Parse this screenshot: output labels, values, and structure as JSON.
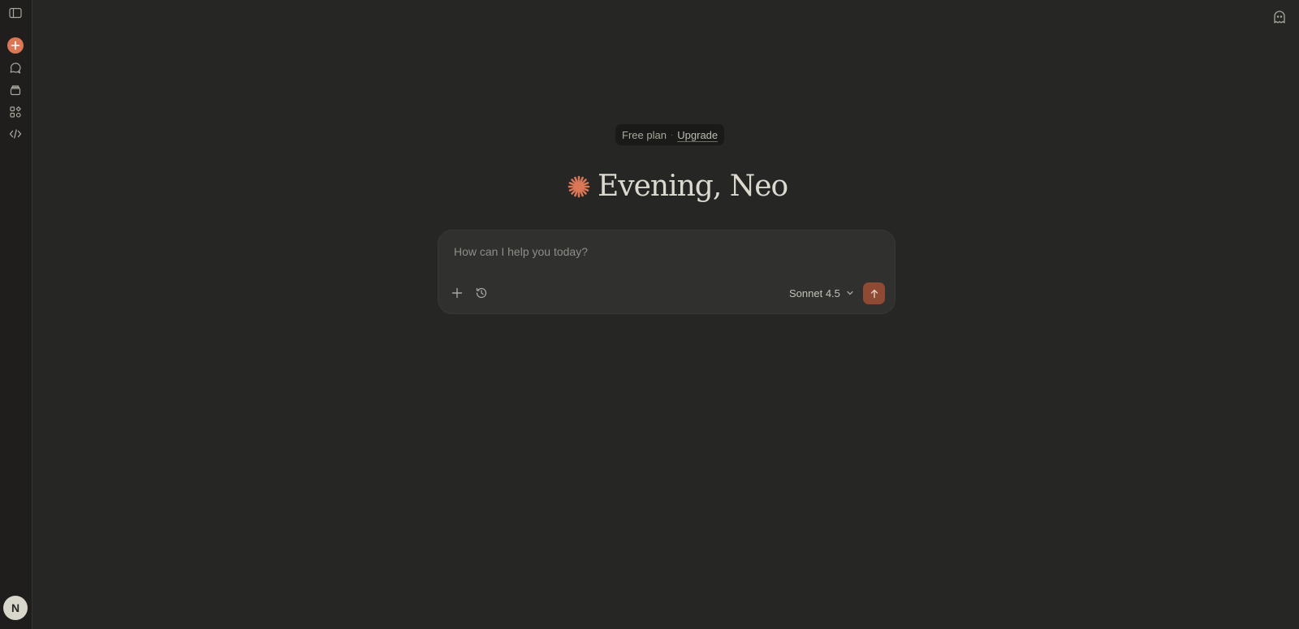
{
  "sidebar": {
    "items": [
      {
        "icon": "sidebar-toggle-icon"
      },
      {
        "icon": "plus-icon",
        "label": "New chat"
      },
      {
        "icon": "chats-icon"
      },
      {
        "icon": "projects-icon"
      },
      {
        "icon": "artifacts-icon"
      },
      {
        "icon": "code-icon"
      }
    ],
    "avatar_initial": "N"
  },
  "header": {
    "plan_label": "Free plan",
    "plan_separator": "·",
    "upgrade_label": "Upgrade"
  },
  "greeting": {
    "text": "Evening, Neo"
  },
  "composer": {
    "placeholder": "How can I help you today?",
    "model": "Sonnet 4.5"
  },
  "colors": {
    "background": "#262624",
    "sidebar": "#1f1e1d",
    "accent": "#d97757",
    "send_button": "#8f4a33",
    "composer": "#30302e"
  }
}
